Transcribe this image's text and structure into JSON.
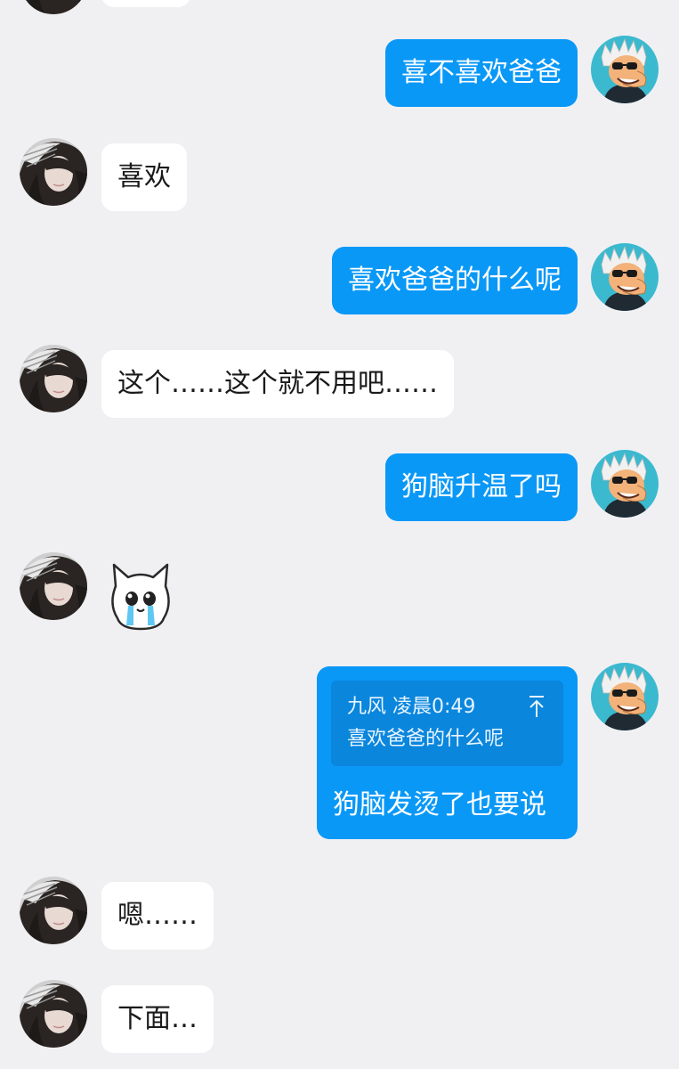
{
  "messages": [
    {
      "side": "out",
      "text": "喜不喜欢爸爸"
    },
    {
      "side": "in",
      "text": "喜欢"
    },
    {
      "side": "out",
      "text": "喜欢爸爸的什么呢"
    },
    {
      "side": "in",
      "text": "这个……这个就不用吧……"
    },
    {
      "side": "out",
      "text": "狗脑升温了吗"
    },
    {
      "side": "in",
      "sticker": "crying-cat-sticker"
    },
    {
      "side": "out",
      "quote": {
        "sender": "九风",
        "time": "凌晨0:49",
        "text": "喜欢爸爸的什么呢"
      },
      "text": "狗脑发烫了也要说"
    },
    {
      "side": "in",
      "text": "嗯……"
    },
    {
      "side": "in",
      "text": "下面…"
    }
  ],
  "colors": {
    "background": "#f0f0f3",
    "outgoing_bubble": "#0a98f7",
    "incoming_bubble": "#ffffff",
    "quote_box": "#0a86dd"
  },
  "icons": {
    "quote_jump": "arrow-up-to-top-icon",
    "avatar_left": "girl-avatar",
    "avatar_right": "cartoon-man-avatar"
  }
}
